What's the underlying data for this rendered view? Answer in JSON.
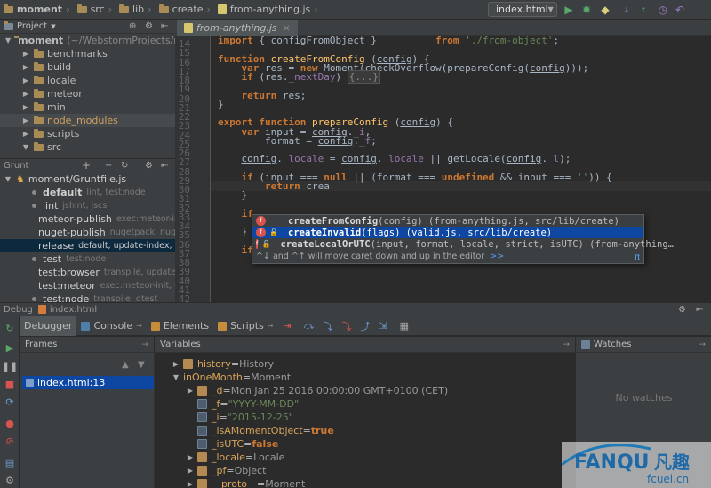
{
  "navbar": {
    "breadcrumbs": [
      "moment",
      "src",
      "lib",
      "create",
      "from-anything.js"
    ],
    "run_config": "index.html"
  },
  "project": {
    "header": "Project",
    "items": [
      {
        "label": "moment",
        "suffix": "(~/WebstormProjects/mom",
        "level": 0,
        "expanded": true
      },
      {
        "label": "benchmarks",
        "level": 1,
        "expanded": false
      },
      {
        "label": "build",
        "level": 1,
        "expanded": false
      },
      {
        "label": "locale",
        "level": 1,
        "expanded": false
      },
      {
        "label": "meteor",
        "level": 1,
        "expanded": false
      },
      {
        "label": "min",
        "level": 1,
        "expanded": false
      },
      {
        "label": "node_modules",
        "level": 1,
        "expanded": false
      },
      {
        "label": "scripts",
        "level": 1,
        "expanded": false
      },
      {
        "label": "src",
        "level": 1,
        "expanded": true
      }
    ]
  },
  "grunt": {
    "header": "Grunt",
    "root": "moment/Gruntfile.js",
    "tasks": [
      {
        "name": "default",
        "desc": "lint, test:node",
        "bold": true
      },
      {
        "name": "lint",
        "desc": "jshint, jscs"
      },
      {
        "name": "meteor-publish",
        "desc": "exec:meteor-init,"
      },
      {
        "name": "nuget-publish",
        "desc": "nugetpack, nugetpu"
      },
      {
        "name": "release",
        "desc": "default, update-index, com",
        "selected": true
      },
      {
        "name": "test",
        "desc": "test:node"
      },
      {
        "name": "test:browser",
        "desc": "transpile, update-ind"
      },
      {
        "name": "test:meteor",
        "desc": "exec:meteor-init, exe"
      },
      {
        "name": "test:node",
        "desc": "transpile, qtest"
      }
    ]
  },
  "editor": {
    "tab": "from-anything.js",
    "line_numbers": [
      "14",
      "15",
      "16",
      "17",
      "18",
      "19",
      "20",
      "21",
      "22",
      "23",
      "24",
      "25",
      "26",
      "27",
      "28",
      "29",
      "30",
      "31",
      "32",
      "33",
      "34",
      "35",
      "36",
      "37",
      "38",
      "39",
      "40",
      "41",
      "42"
    ],
    "code": {
      "l14a": "import",
      "l14b": " { configFromObject }          ",
      "l14c": "from",
      "l14d": " ",
      "l14e": "'./from-object'",
      "l14f": ";",
      "l16a": "function",
      "l16b": " ",
      "l16c": "createFromConfig",
      "l16d": " (",
      "l16e": "config",
      "l16f": ") {",
      "l17a": "    ",
      "l17b": "var",
      "l17c": " res = ",
      "l17d": "new",
      "l17e": " Moment(checkOverflow(prepareConfig(",
      "l17f": "config",
      "l17g": ")));",
      "l18a": "    ",
      "l18b": "if",
      "l18c": " (res.",
      "l18d": "_nextDay",
      "l18e": ") ",
      "l18f": "{...}",
      "l20a": "    ",
      "l20b": "return",
      "l20c": " res;",
      "l21": "}",
      "l23a": "export",
      "l23b": " ",
      "l23c": "function",
      "l23d": " ",
      "l23e": "prepareConfig",
      "l23f": " (",
      "l23g": "config",
      "l23h": ") {",
      "l24a": "    ",
      "l24b": "var",
      "l24c": " input = ",
      "l24d": "config",
      "l24e": ".",
      "l24f": "_i",
      "l24g": ",",
      "l25a": "        format = ",
      "l25b": "config",
      "l25c": ".",
      "l25d": "_f",
      "l25e": ";",
      "l27a": "    ",
      "l27b": "config",
      "l27c": ".",
      "l27d": "_locale",
      "l27e": " = ",
      "l27f": "config",
      "l27g": ".",
      "l27h": "_locale",
      "l27i": " || getLocale(",
      "l27j": "config",
      "l27k": ".",
      "l27l": "_l",
      "l27m": ");",
      "l29a": "    ",
      "l29b": "if",
      "l29c": " (input === ",
      "l29d": "null",
      "l29e": " || (format === ",
      "l29f": "undefined",
      "l29g": " && input === ",
      "l29h": "''",
      "l29i": ")) {",
      "l30a": "        ",
      "l30b": "return",
      "l30c": " crea",
      "l31": "    }",
      "l33a": "    ",
      "l33b": "if",
      "l35": "    }",
      "l37a": "    ",
      "l37b": "if",
      "l37c": " (isMoment(input)) {",
      "l38a": "        ",
      "l38b": "return",
      "l38c": " ",
      "l38d": "new",
      "l38e": " Moment(checkOverflow(input));"
    }
  },
  "completion": {
    "items": [
      {
        "bold": "createFromConfig",
        "rest": "(config) (from-anything.js, src/lib/create)",
        "selected": false,
        "locked": false
      },
      {
        "bold": "createInvalid",
        "rest": "(flags) (valid.js, src/lib/create)",
        "selected": true,
        "locked": true
      },
      {
        "bold": "createLocalOrUTC",
        "rest": "(input, format, locale, strict, isUTC) (from-anything…",
        "selected": false,
        "locked": true
      }
    ],
    "hint": "^↓ and ^↑ will move caret down and up in the editor",
    "hint_link": ">>",
    "pi": "π"
  },
  "debug": {
    "title": "Debug",
    "config": "index.html",
    "tabs": [
      "Debugger",
      "Console",
      "Elements",
      "Scripts"
    ],
    "frames_header": "Frames",
    "variables_header": "Variables",
    "watches_header": "Watches",
    "frame_selected": "index.html:13",
    "no_watches": "No watches",
    "variables": [
      {
        "name": "history",
        "value": "History",
        "type": "obj",
        "indent": 0,
        "arrow": "▶",
        "vclass": "vval"
      },
      {
        "name": "inOneMonth",
        "value": "Moment",
        "type": "none",
        "indent": 0,
        "arrow": "▼",
        "vclass": "vval"
      },
      {
        "name": "_d",
        "value": "Mon Jan 25 2016 00:00:00 GMT+0100 (CET)",
        "type": "obj",
        "indent": 1,
        "arrow": "▶",
        "vclass": "vval"
      },
      {
        "name": "_f",
        "value": "\"YYYY-MM-DD\"",
        "type": "prim",
        "indent": 1,
        "arrow": "",
        "vclass": "vstr"
      },
      {
        "name": "_i",
        "value": "\"2015-12-25\"",
        "type": "prim",
        "indent": 1,
        "arrow": "",
        "vclass": "vstr"
      },
      {
        "name": "_isAMomentObject",
        "value": "true",
        "type": "prim",
        "indent": 1,
        "arrow": "",
        "vclass": "vbool"
      },
      {
        "name": "_isUTC",
        "value": "false",
        "type": "prim",
        "indent": 1,
        "arrow": "",
        "vclass": "vbool"
      },
      {
        "name": "_locale",
        "value": "Locale",
        "type": "obj",
        "indent": 1,
        "arrow": "▶",
        "vclass": "vval"
      },
      {
        "name": "_pf",
        "value": "Object",
        "type": "obj",
        "indent": 1,
        "arrow": "▶",
        "vclass": "vval"
      },
      {
        "name": "__proto__",
        "value": "Moment",
        "type": "obj",
        "indent": 1,
        "arrow": "▶",
        "vclass": "vval"
      }
    ]
  },
  "watermark": {
    "brand": "FANQU",
    "brand_cn": "凡趣",
    "site": "fcuel.cn"
  },
  "colors": {
    "accent_selection": "#0d47a1",
    "keyword": "#cc7832",
    "string": "#6a8759",
    "function": "#ffc66d",
    "field": "#9876aa"
  }
}
